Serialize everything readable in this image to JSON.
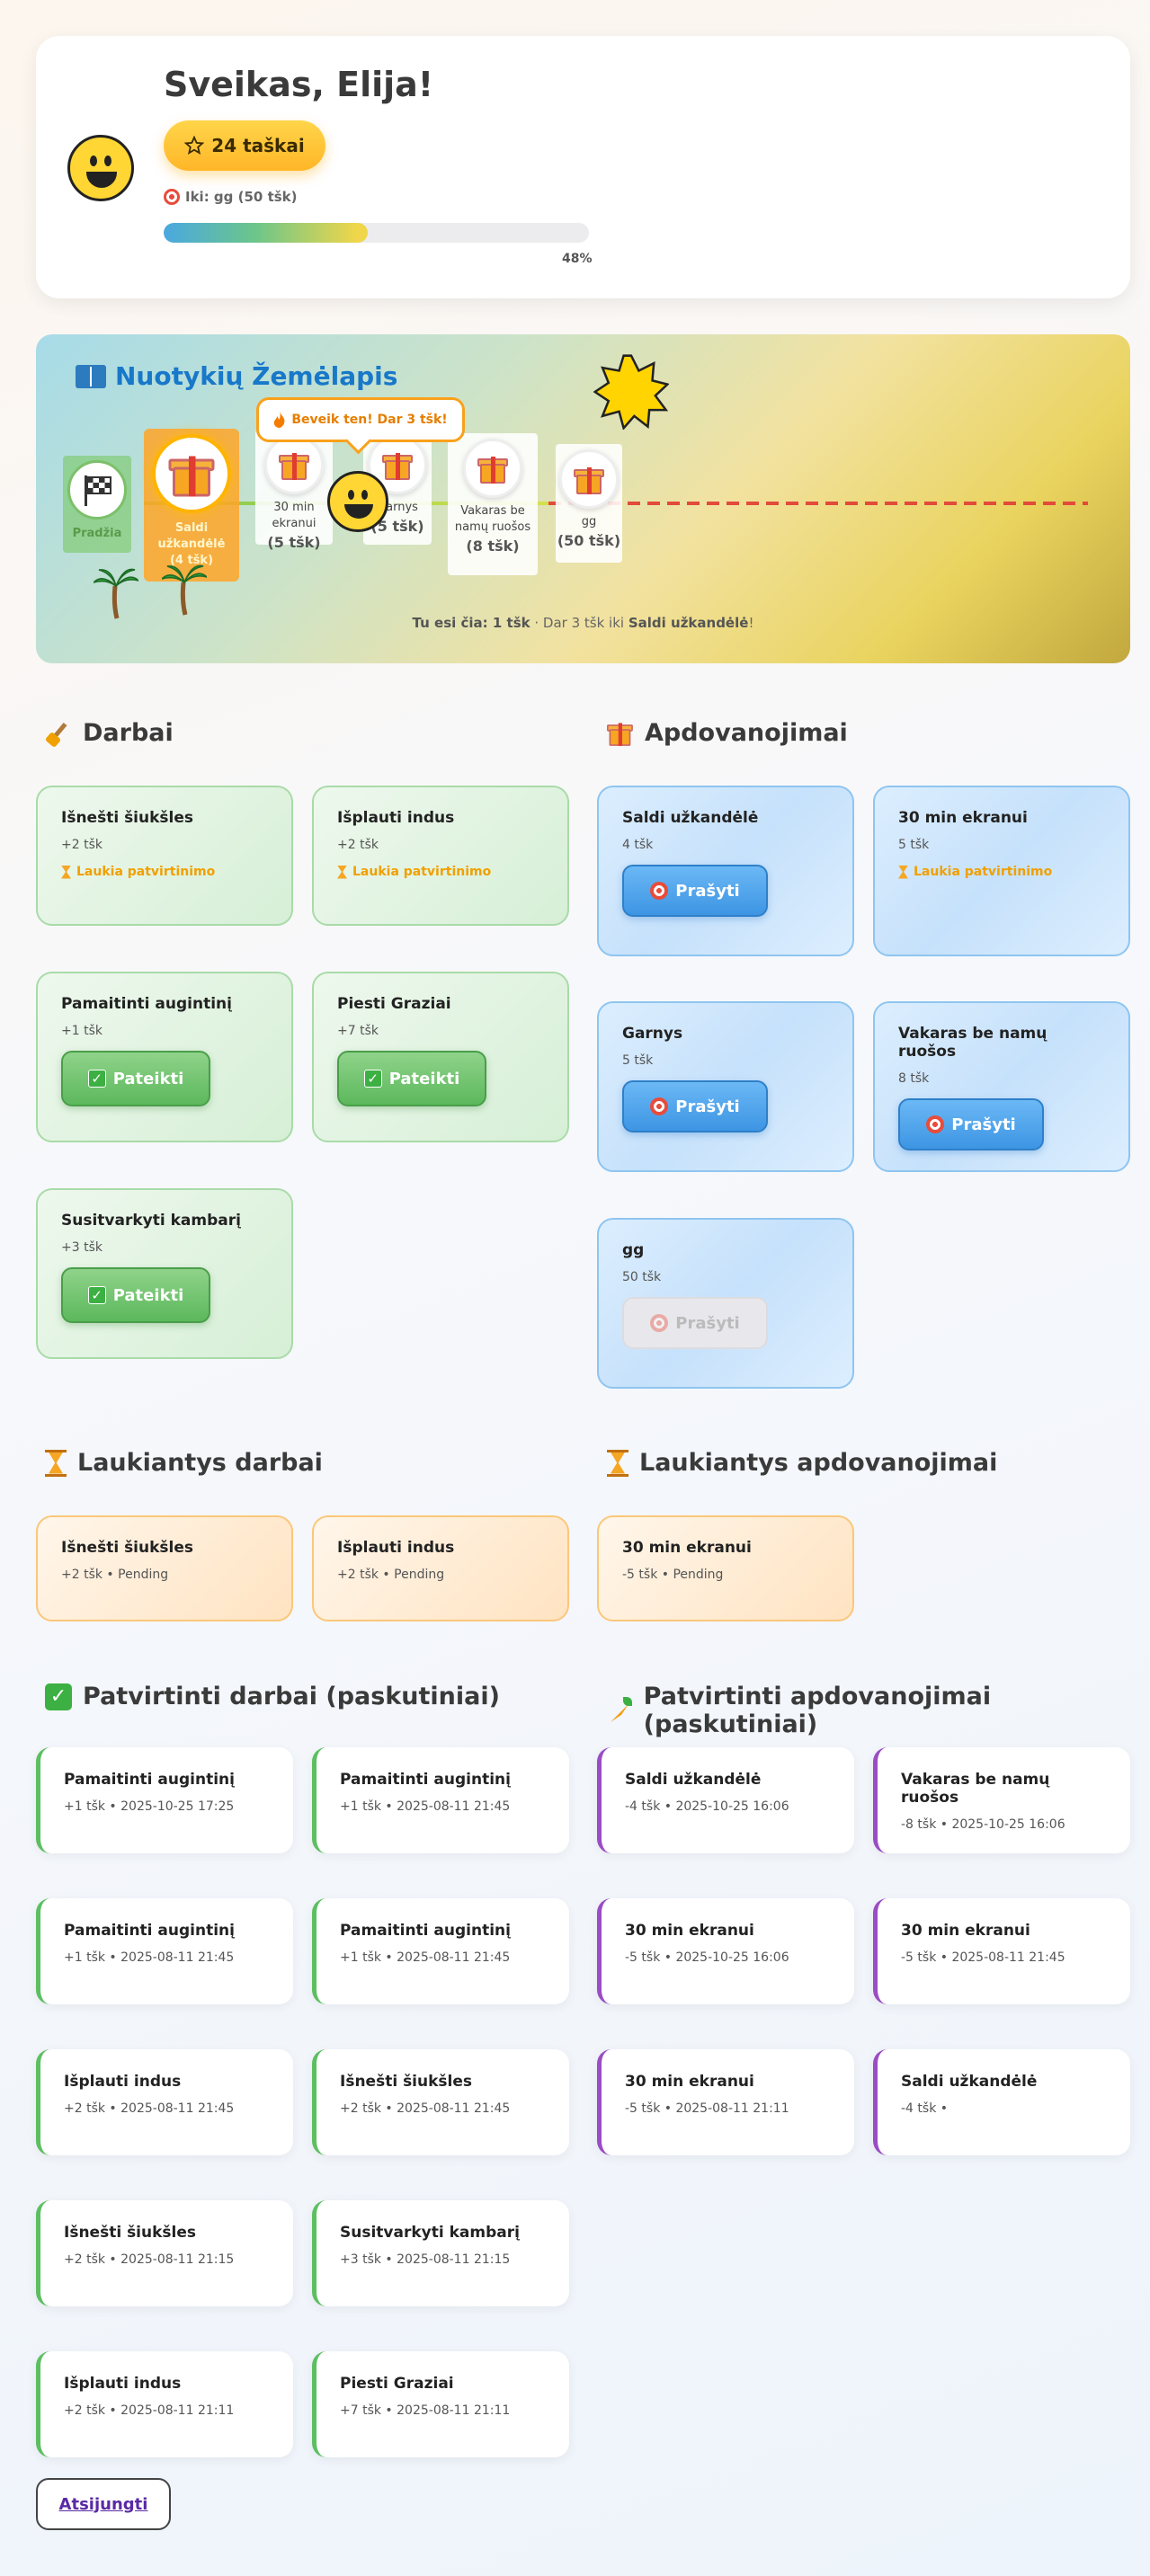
{
  "header": {
    "greeting": "Sveikas, Elija!",
    "points_label": "24 taškai",
    "goal_label": "Iki: gg (50 tšk)",
    "progress_percent_label": "48%",
    "progress_fraction": 0.48
  },
  "map": {
    "title": "Nuotykių Žemėlapis",
    "start_label": "Pradžia",
    "current_name": "Saldi užkandėlė",
    "current_points": "(4 tšk)",
    "bubble": "Beveik ten! Dar 3 tšk!",
    "nodes": [
      {
        "name": "30 min ekranui",
        "points": "(5 tšk)"
      },
      {
        "name": "Garnys",
        "points": "(5 tšk)"
      },
      {
        "name": "Vakaras be namų ruošos",
        "points": "(8 tšk)"
      },
      {
        "name": "gg",
        "points": "(50 tšk)"
      }
    ],
    "status_prefix": "Tu esi čia: 1 tšk",
    "status_middle": " · Dar 3 tšk iki ",
    "status_target": "Saldi užkandėlė",
    "status_suffix": "!"
  },
  "chores": {
    "title": "Darbai",
    "items": [
      {
        "name": "Išnešti šiukšles",
        "points": "+2 tšk",
        "status": "Laukia patvirtinimo"
      },
      {
        "name": "Išplauti indus",
        "points": "+2 tšk",
        "status": "Laukia patvirtinimo"
      },
      {
        "name": "Pamaitinti augintinį",
        "points": "+1 tšk",
        "button": "Pateikti"
      },
      {
        "name": "Piesti Graziai",
        "points": "+7 tšk",
        "button": "Pateikti"
      },
      {
        "name": "Susitvarkyti kambarį",
        "points": "+3 tšk",
        "button": "Pateikti"
      }
    ]
  },
  "rewards": {
    "title": "Apdovanojimai",
    "items": [
      {
        "name": "Saldi užkandėlė",
        "points": "4 tšk",
        "button": "Prašyti"
      },
      {
        "name": "30 min ekranui",
        "points": "5 tšk",
        "status": "Laukia patvirtinimo"
      },
      {
        "name": "Garnys",
        "points": "5 tšk",
        "button": "Prašyti"
      },
      {
        "name": "Vakaras be namų ruošos",
        "points": "8 tšk",
        "button": "Prašyti"
      },
      {
        "name": "gg",
        "points": "50 tšk",
        "button": "Prašyti"
      }
    ]
  },
  "pending_chores": {
    "title": "Laukiantys darbai",
    "items": [
      {
        "name": "Išnešti šiukšles",
        "detail": "+2 tšk • Pending"
      },
      {
        "name": "Išplauti indus",
        "detail": "+2 tšk • Pending"
      }
    ]
  },
  "pending_rewards": {
    "title": "Laukiantys apdovanojimai",
    "items": [
      {
        "name": "30 min ekranui",
        "detail": "-5 tšk • Pending"
      }
    ]
  },
  "approved_chores": {
    "title": "Patvirtinti darbai (paskutiniai)",
    "items": [
      {
        "name": "Pamaitinti augintinį",
        "detail": "+1 tšk • 2025-10-25 17:25"
      },
      {
        "name": "Pamaitinti augintinį",
        "detail": "+1 tšk • 2025-08-11 21:45"
      },
      {
        "name": "Pamaitinti augintinį",
        "detail": "+1 tšk • 2025-08-11 21:45"
      },
      {
        "name": "Pamaitinti augintinį",
        "detail": "+1 tšk • 2025-08-11 21:45"
      },
      {
        "name": "Išplauti indus",
        "detail": "+2 tšk • 2025-08-11 21:45"
      },
      {
        "name": "Išnešti šiukšles",
        "detail": "+2 tšk • 2025-08-11 21:45"
      },
      {
        "name": "Išnešti šiukšles",
        "detail": "+2 tšk • 2025-08-11 21:15"
      },
      {
        "name": "Susitvarkyti kambarį",
        "detail": "+3 tšk • 2025-08-11 21:15"
      },
      {
        "name": "Išplauti indus",
        "detail": "+2 tšk • 2025-08-11 21:11"
      },
      {
        "name": "Piesti Graziai",
        "detail": "+7 tšk • 2025-08-11 21:11"
      }
    ]
  },
  "approved_rewards": {
    "title": "Patvirtinti apdovanojimai (paskutiniai)",
    "items": [
      {
        "name": "Saldi užkandėlė",
        "detail": "-4 tšk • 2025-10-25 16:06"
      },
      {
        "name": "Vakaras be namų ruošos",
        "detail": "-8 tšk • 2025-10-25 16:06"
      },
      {
        "name": "30 min ekranui",
        "detail": "-5 tšk • 2025-10-25 16:06"
      },
      {
        "name": "30 min ekranui",
        "detail": "-5 tšk • 2025-08-11 21:45"
      },
      {
        "name": "30 min ekranui",
        "detail": "-5 tšk • 2025-08-11 21:11"
      },
      {
        "name": "Saldi užkandėlė",
        "detail": "-4 tšk •"
      }
    ]
  },
  "logout_label": "Atsijungti"
}
